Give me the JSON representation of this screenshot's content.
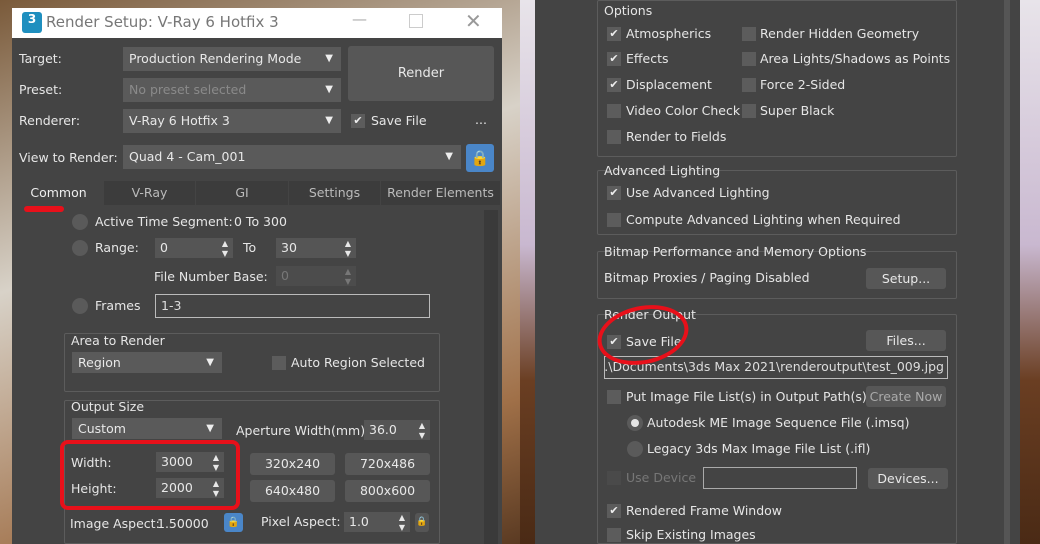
{
  "left": {
    "title": "Render Setup: V-Ray 6 Hotfix 3",
    "app_icon_text": "3",
    "target": {
      "label": "Target:",
      "value": "Production Rendering Mode"
    },
    "preset": {
      "label": "Preset:",
      "value": "No preset selected"
    },
    "renderer": {
      "label": "Renderer:",
      "value": "V-Ray 6 Hotfix 3"
    },
    "render_button": "Render",
    "save_file": "Save File",
    "more": "...",
    "view": {
      "label": "View to Render:",
      "value": "Quad 4 - Cam_001"
    },
    "tabs": [
      "Common",
      "V-Ray",
      "GI",
      "Settings",
      "Render Elements"
    ],
    "time": {
      "active_label": "Active Time Segment:",
      "active_value": "0 To 300",
      "range_label": "Range:",
      "range_from": "0",
      "to_label": "To",
      "range_to": "30",
      "file_base_label": "File Number Base:",
      "file_base": "0",
      "frames_label": "Frames",
      "frames_value": "1-3"
    },
    "area": {
      "title": "Area to Render",
      "value": "Region",
      "auto_region": "Auto Region Selected"
    },
    "output": {
      "title": "Output Size",
      "preset": "Custom",
      "aperture_label": "Aperture Width(mm):",
      "aperture": "36.0",
      "width_label": "Width:",
      "width": "3000",
      "height_label": "Height:",
      "height": "2000",
      "presets": [
        "320x240",
        "720x486",
        "640x480",
        "800x600"
      ],
      "image_aspect_label": "Image Aspect:",
      "image_aspect": "1.50000",
      "pixel_aspect_label": "Pixel Aspect:",
      "pixel_aspect": "1.0"
    }
  },
  "right": {
    "options": {
      "title": "Options",
      "col1": [
        {
          "label": "Atmospherics",
          "checked": true
        },
        {
          "label": "Effects",
          "checked": true
        },
        {
          "label": "Displacement",
          "checked": true
        },
        {
          "label": "Video Color Check",
          "checked": false
        },
        {
          "label": "Render to Fields",
          "checked": false
        }
      ],
      "col2": [
        {
          "label": "Render Hidden Geometry",
          "checked": false
        },
        {
          "label": "Area Lights/Shadows as Points",
          "checked": false
        },
        {
          "label": "Force 2-Sided",
          "checked": false
        },
        {
          "label": "Super Black",
          "checked": false
        }
      ]
    },
    "advanced": {
      "title": "Advanced Lighting",
      "use": "Use Advanced Lighting",
      "compute": "Compute Advanced Lighting when Required"
    },
    "bitmap": {
      "title": "Bitmap Performance and Memory Options",
      "status": "Bitmap Proxies / Paging Disabled",
      "setup": "Setup..."
    },
    "render_output": {
      "title": "Render Output",
      "save_file": "Save File",
      "files": "Files...",
      "path": "...\\Documents\\3ds Max 2021\\renderoutput\\test_009.jpg",
      "put_list": "Put Image File List(s) in Output Path(s)",
      "create_now": "Create Now",
      "imsq": "Autodesk ME Image Sequence File (.imsq)",
      "ifl": "Legacy 3ds Max Image File List (.ifl)",
      "use_device": "Use Device",
      "devices": "Devices...",
      "rfw": "Rendered Frame Window",
      "skip": "Skip Existing Images"
    }
  },
  "colors": {
    "annotation": "#e8101a",
    "lock": "#4a86c8"
  }
}
